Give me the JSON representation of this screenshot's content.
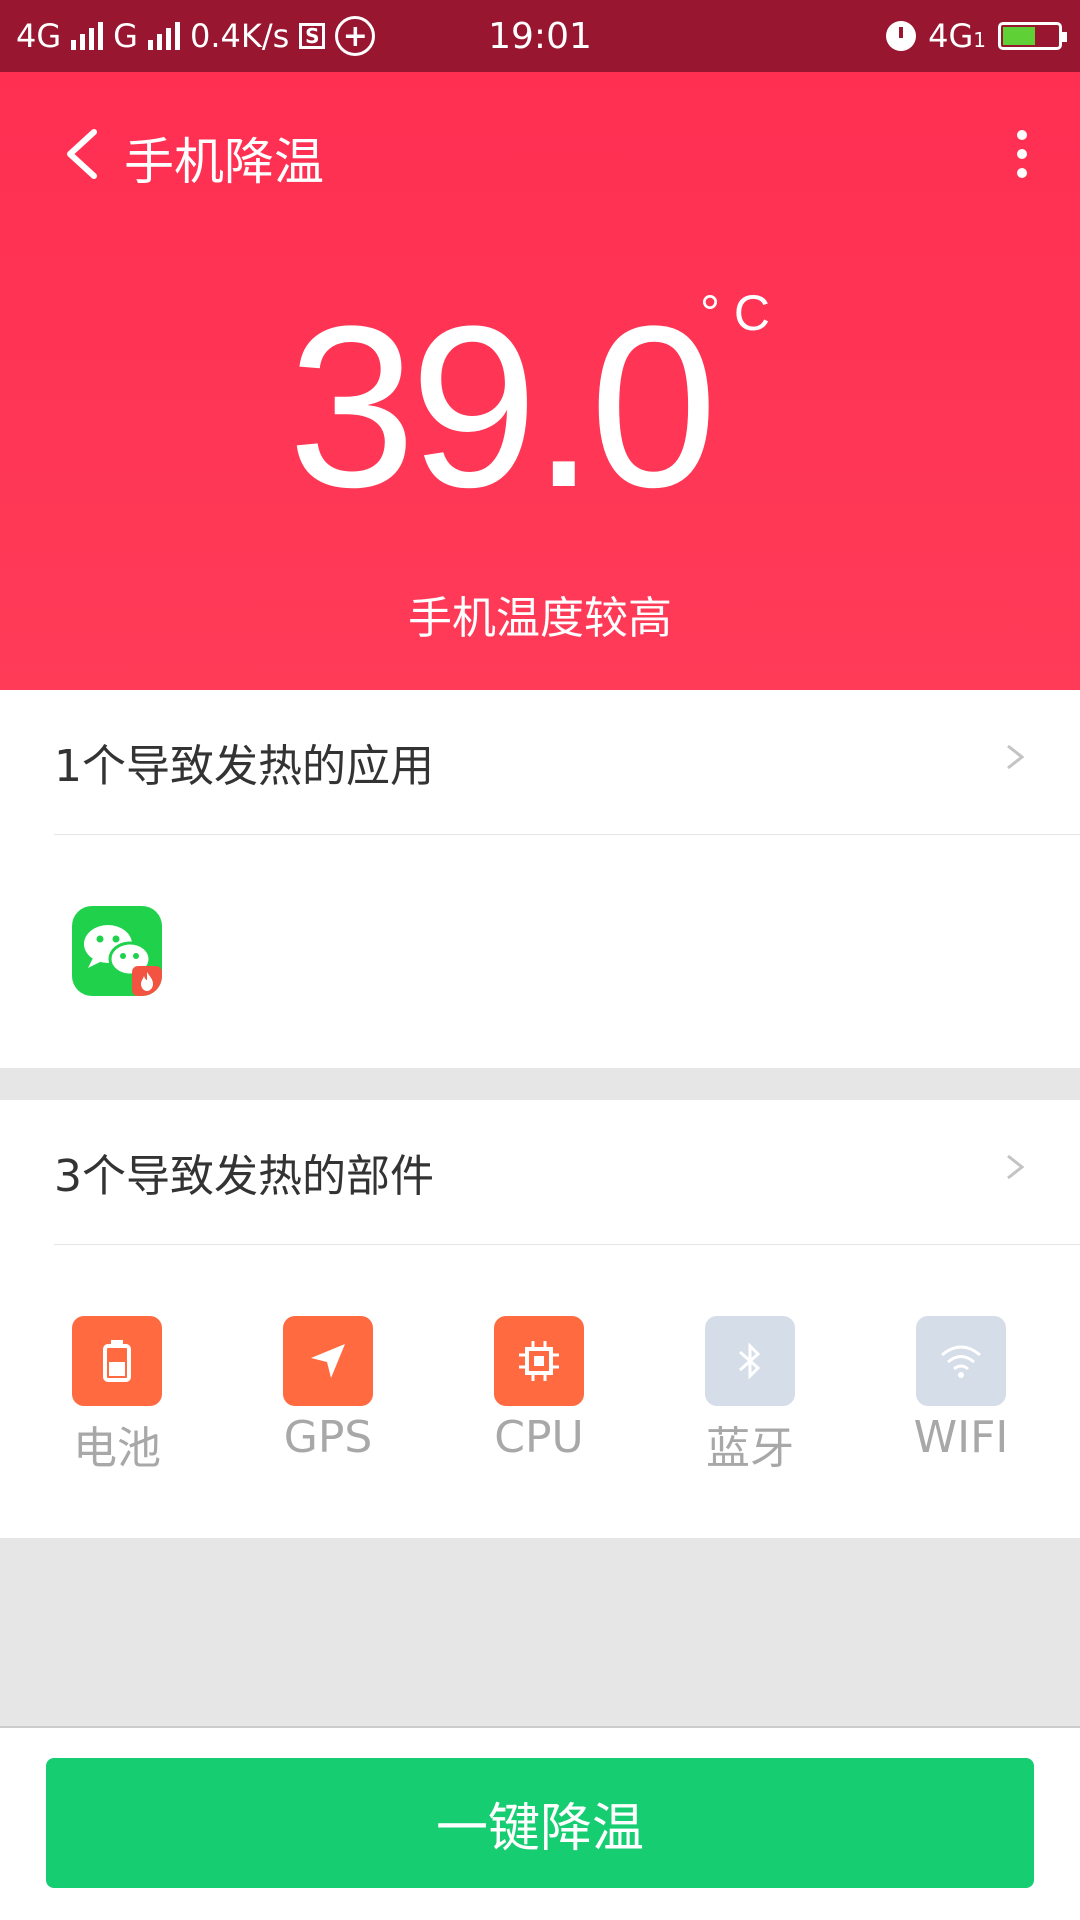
{
  "status_bar": {
    "net1": "4G",
    "net2": "G",
    "speed": "0.4K/s",
    "time": "19:01",
    "net3": "4G",
    "sim_tag": "1",
    "s_icon": "S"
  },
  "header": {
    "title": "手机降温"
  },
  "temperature": {
    "value": "39.0",
    "unit": "° C",
    "status": "手机温度较高"
  },
  "apps_section": {
    "title": "1个导致发热的应用",
    "apps": [
      {
        "name": "wechat-icon"
      }
    ]
  },
  "parts_section": {
    "title": "3个导致发热的部件",
    "items": [
      {
        "label": "电池",
        "icon": "battery-icon",
        "active": true
      },
      {
        "label": "GPS",
        "icon": "location-arrow-icon",
        "active": true
      },
      {
        "label": "CPU",
        "icon": "chip-icon",
        "active": true
      },
      {
        "label": "蓝牙",
        "icon": "bluetooth-icon",
        "active": false
      },
      {
        "label": "WIFI",
        "icon": "wifi-icon",
        "active": false
      }
    ]
  },
  "colors": {
    "hero": "#ff3155",
    "status_bar": "#98162f",
    "active_part": "#ff6a40",
    "inactive_part": "#d5dde8",
    "cta": "#17cd72"
  },
  "action": {
    "label": "一键降温"
  }
}
